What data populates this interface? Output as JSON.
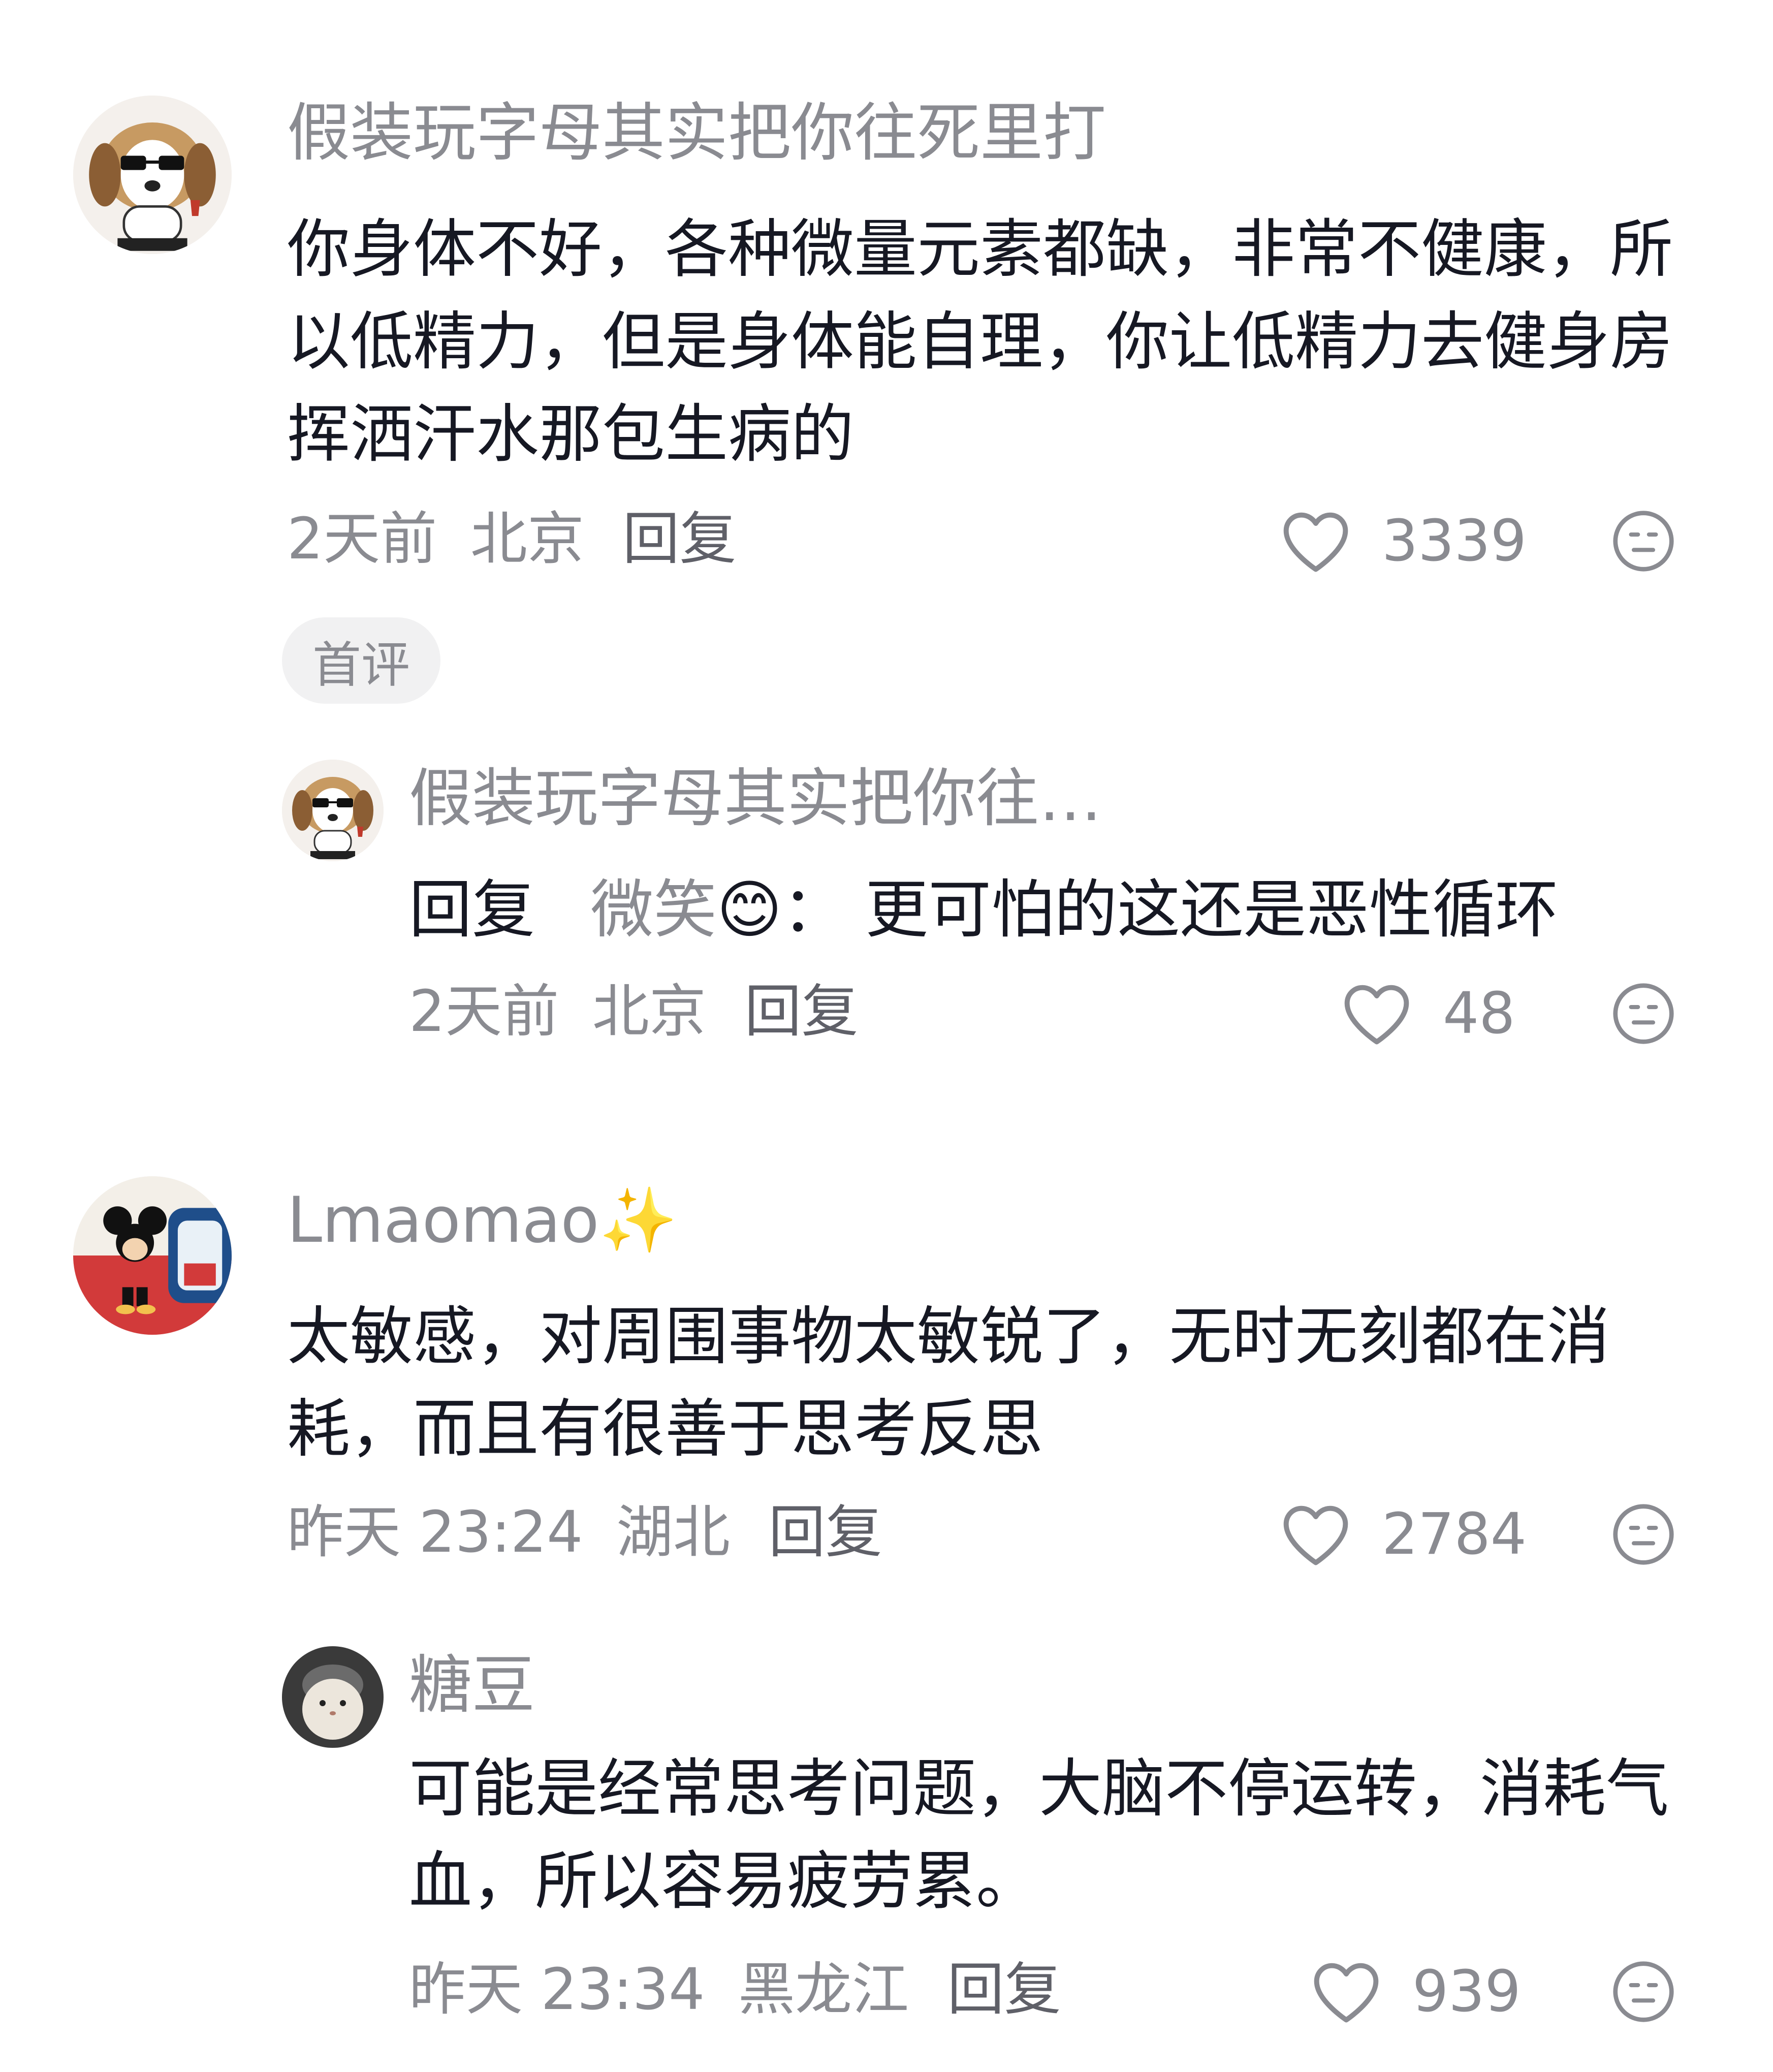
{
  "comments": [
    {
      "username": "假装玩字母其实把你往死里打",
      "text": "你身体不好，各种微量元素都缺，非常不健康，所以低精力，但是身体能自理，你让低精力去健身房挥洒汗水那包生病的",
      "time": "2天前",
      "location": "北京",
      "reply_label": "回复",
      "likes": "3339",
      "badge": "首评",
      "replies": [
        {
          "username": "假装玩字母其实把你往…",
          "reply_prefix": "回复",
          "reply_to": "微笑",
          "emoji": "😊",
          "separator": "：",
          "text": "更可怕的这还是恶性循环",
          "time": "2天前",
          "location": "北京",
          "reply_label": "回复",
          "likes": "48"
        }
      ]
    },
    {
      "username": "Lmaomao✨",
      "text": "太敏感，对周围事物太敏锐了，无时无刻都在消耗，而且有很善于思考反思",
      "time": "昨天 23:24",
      "location": "湖北",
      "reply_label": "回复",
      "likes": "2784",
      "replies": [
        {
          "username": "糖豆",
          "text": "可能是经常思考问题，大脑不停运转，消耗气血，所以容易疲劳累。",
          "time": "昨天 23:34",
          "location": "黑龙江",
          "reply_label": "回复",
          "likes": "939"
        }
      ]
    }
  ],
  "icons": {
    "like": "heart-outline-icon",
    "dislike": "neutral-face-icon"
  },
  "colors": {
    "text": "#161823",
    "secondary": "#8a8b91",
    "badge_bg": "#f1f1f2"
  }
}
